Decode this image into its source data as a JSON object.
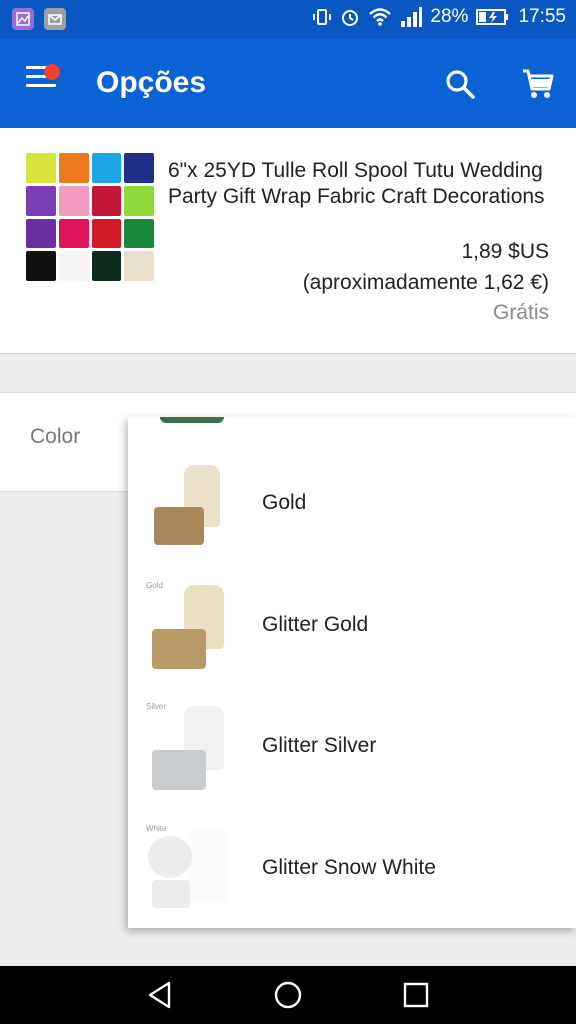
{
  "status_bar": {
    "battery": "28%",
    "time": "17:55"
  },
  "app_bar": {
    "title": "Opções"
  },
  "product": {
    "title": "6\"x 25YD Tulle Roll Spool Tutu Wedding Party Gift Wrap Fabric Craft Decorations",
    "price": "1,89 $US",
    "approx_price": "(aproximadamente 1,62 €)",
    "shipping": "Grátis",
    "thumbnail_colors": [
      "#d8e43a",
      "#ef7a1e",
      "#1ba7e6",
      "#1f2f8a",
      "#7a3fb4",
      "#f39bc0",
      "#c2183a",
      "#8ed83a",
      "#6a2fa0",
      "#e0145c",
      "#d21a28",
      "#1a8a3a",
      "#111111",
      "#f4f4f4",
      "#0f2c1c",
      "#e8e0cc"
    ]
  },
  "color_selector": {
    "label": "Color",
    "options": [
      {
        "label": "Gold",
        "tag": "",
        "roll_color": "#a8875a",
        "tulle_color": "#d9c7a0"
      },
      {
        "label": "Glitter Gold",
        "tag": "Gold",
        "roll_color": "#b79a66",
        "tulle_color": "#d8c48d"
      },
      {
        "label": "Glitter Silver",
        "tag": "Silver",
        "roll_color": "#c9cccf",
        "tulle_color": "#e4e6e8"
      },
      {
        "label": "Glitter Snow White",
        "tag": "White",
        "roll_color": "#ececec",
        "tulle_color": "#f7f7f7"
      }
    ]
  },
  "colors": {
    "status_bar": "#0a56c2",
    "app_bar": "#0a62d4",
    "notification_dot": "#f0422f"
  }
}
